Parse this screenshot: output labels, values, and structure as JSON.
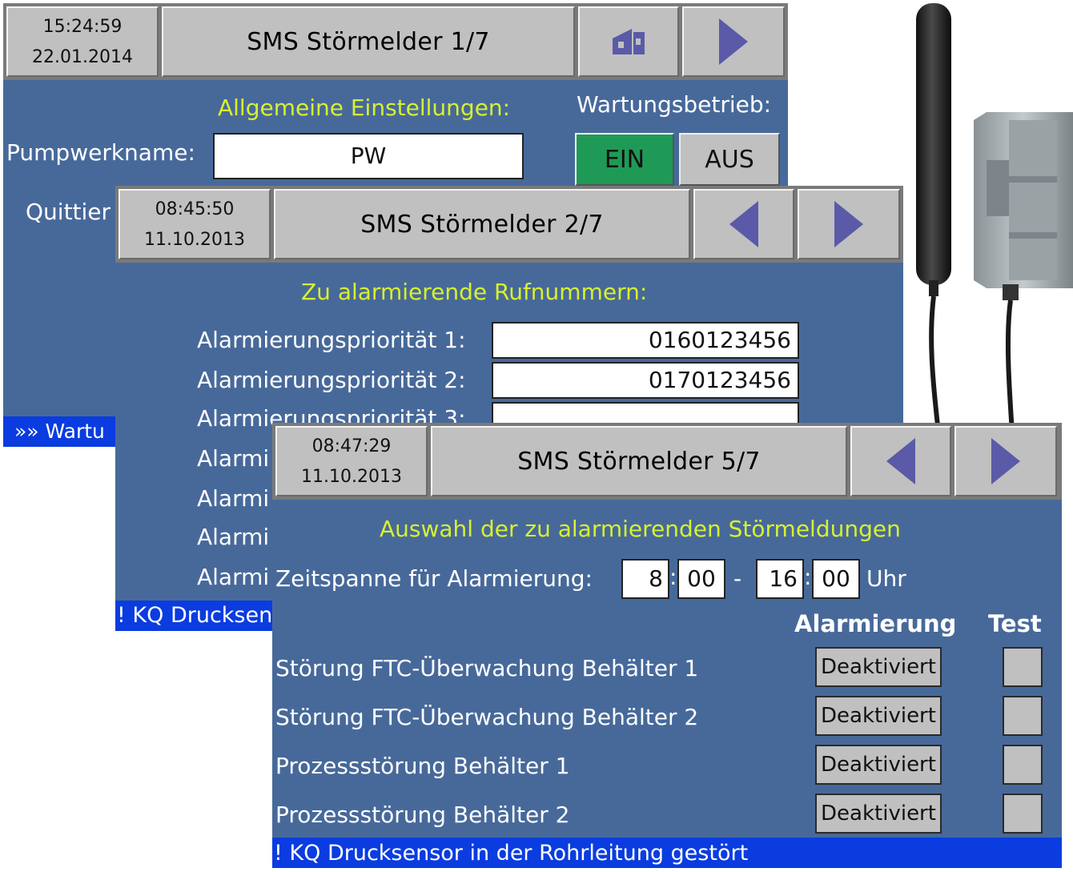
{
  "colors": {
    "panel_bg": "#47699a",
    "accent_yellow": "#d8f030",
    "active_green": "#1f9a56",
    "status_blue": "#0a3ce0",
    "arrow": "#5a5aa8"
  },
  "screen1": {
    "time": "15:24:59",
    "date": "22.01.2014",
    "title": "SMS Störmelder 1/7",
    "home_icon": "home-icon",
    "next_icon": "arrow-right-icon",
    "section": "Allgemeine Einstellungen:",
    "maintenance_label": "Wartungsbetrieb:",
    "name_label": "Pumpwerkname:",
    "name_value": "PW",
    "btn_on": "EIN",
    "btn_off": "AUS",
    "quit_label": "Quittier",
    "status": "»» Wartu"
  },
  "screen2": {
    "time": "08:45:50",
    "date": "11.10.2013",
    "title": "SMS Störmelder 2/7",
    "prev_icon": "arrow-left-icon",
    "next_icon": "arrow-right-icon",
    "section": "Zu alarmierende Rufnummern:",
    "rows": [
      {
        "label": "Alarmierungspriorität 1:",
        "value": "0160123456"
      },
      {
        "label": "Alarmierungspriorität 2:",
        "value": "0170123456"
      },
      {
        "label": "Alarmierungspriorität 3:",
        "value": ""
      }
    ],
    "hidden_rows": [
      "Alarmi",
      "Alarmi",
      "Alarmi",
      "Alarmi"
    ],
    "status": "! KQ Drucksen"
  },
  "screen5": {
    "time": "08:47:29",
    "date": "11.10.2013",
    "title": "SMS Störmelder 5/7",
    "prev_icon": "arrow-left-icon",
    "next_icon": "arrow-right-icon",
    "section": "Auswahl der zu alarmierenden Störmeldungen",
    "period_label": "Zeitspanne für Alarmierung:",
    "from_h": "8",
    "from_m": "00",
    "dash": "-",
    "to_h": "16",
    "to_m": "00",
    "uhr": "Uhr",
    "col_alarm": "Alarmierung",
    "col_test": "Test",
    "alarms": [
      {
        "label": "Störung FTC-Überwachung Behälter 1",
        "state": "Deaktiviert"
      },
      {
        "label": "Störung FTC-Überwachung Behälter 2",
        "state": "Deaktiviert"
      },
      {
        "label": "Prozessstörung Behälter 1",
        "state": "Deaktiviert"
      },
      {
        "label": "Prozessstörung Behälter 2",
        "state": "Deaktiviert"
      }
    ],
    "status": "! KQ Drucksensor in der Rohrleitung gestört"
  }
}
